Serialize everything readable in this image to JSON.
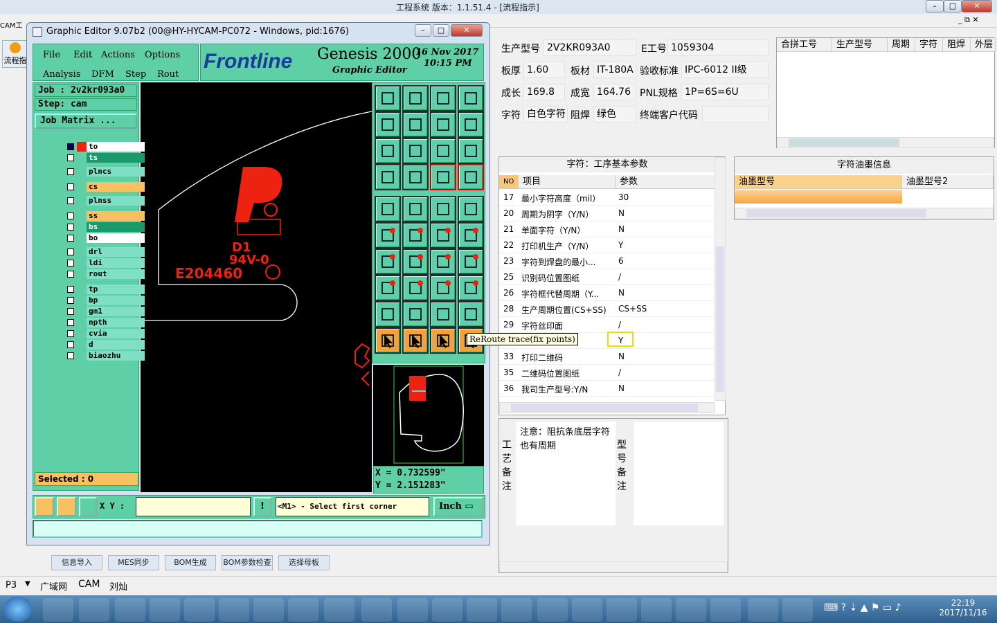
{
  "app_title": "工程系统   版本：1.1.51.4 - [流程指示]",
  "left_tab": "CAM工",
  "left_button": "流程指",
  "product": {
    "model_label": "生产型号",
    "model_value": "2V2KR093A0",
    "eno_label": "E工号",
    "eno_value": "1059304",
    "thick_label": "板厚",
    "thick_value": "1.60",
    "mat_label": "板材",
    "mat_value": "IT-180A",
    "std_label": "验收标准",
    "std_value": "IPC-6012 II级",
    "len_label": "成长",
    "len_value": "169.8",
    "wid_label": "成宽",
    "wid_value": "164.76",
    "pnl_label": "PNL规格",
    "pnl_value": "1P=6S=6U",
    "char_label": "字符",
    "char_value": "白色字符",
    "mask_label": "阻焊",
    "mask_value": "绿色",
    "cust_label": "终端客户代码",
    "cust_value": ""
  },
  "merge_table": {
    "headers": [
      "合拼工号",
      "生产型号",
      "周期",
      "字符",
      "阻焊",
      "外层"
    ]
  },
  "params": {
    "title": "字符：工序基本参数",
    "col_no": "NO",
    "col_item": "项目",
    "col_param": "参数",
    "rows": [
      {
        "no": "17",
        "item": "最小字符高度（mil）",
        "val": "30"
      },
      {
        "no": "20",
        "item": "周期为阴字（Y/N）",
        "val": "N"
      },
      {
        "no": "21",
        "item": "单面字符（Y/N）",
        "val": "N"
      },
      {
        "no": "22",
        "item": "打印机生产（Y/N）",
        "val": "Y"
      },
      {
        "no": "23",
        "item": "字符到焊盘的最小...",
        "val": "6"
      },
      {
        "no": "25",
        "item": "识别码位置图纸",
        "val": "/"
      },
      {
        "no": "26",
        "item": "字符框代替周期（Y...",
        "val": "N"
      },
      {
        "no": "28",
        "item": "生产周期位置(CS+SS)",
        "val": "CS+SS"
      },
      {
        "no": "29",
        "item": "字符丝印面",
        "val": "/"
      },
      {
        "no": "31",
        "item": "/N)",
        "val": "Y"
      },
      {
        "no": "33",
        "item": "打印二维码",
        "val": "N"
      },
      {
        "no": "35",
        "item": "二维码位置图纸",
        "val": "/"
      },
      {
        "no": "36",
        "item": "我司生产型号:Y/N",
        "val": "N"
      }
    ]
  },
  "ink": {
    "title": "字符油墨信息",
    "col1": "油墨型号",
    "col2": "油墨型号2"
  },
  "notes": {
    "proc_label": [
      "工",
      "艺",
      "备",
      "注"
    ],
    "proc_text": "注意：阻抗条底层字符也有周期",
    "model_label": [
      "型",
      "号",
      "备",
      "注"
    ]
  },
  "tooltip": "ReRoute trace(fix points)",
  "genesis": {
    "title": "Graphic Editor 9.07b2 (00@HY-HYCAM-PC072 - Windows, pid:1676)",
    "menu": [
      "File",
      "Edit",
      "Actions",
      "Options",
      "Analysis",
      "DFM",
      "Step",
      "Rout"
    ],
    "brand": "Frontline",
    "product": "Genesis 2000",
    "subtitle": "Graphic Editor",
    "date": "16 Nov 2017",
    "time": "10:15 PM",
    "job": "Job : 2v2kr093a0",
    "step": "Step: cam",
    "job_matrix": "Job Matrix ...",
    "layers": [
      "to",
      "ts",
      "plncs",
      "cs",
      "plnss",
      "ss",
      "bs",
      "bo",
      "drl",
      "ldi",
      "rout",
      "tp",
      "bp",
      "gm1",
      "npth",
      "cvia",
      "d",
      "biaozhu"
    ],
    "selected": "Selected : 0",
    "xy_label": "X Y :",
    "status": "<M1> - Select first corner",
    "unit": "Inch",
    "coord_x": "X = 0.732599\"",
    "coord_y": "Y = 2.151283\"",
    "pcb_text1": "D1",
    "pcb_text2": "94V-0",
    "pcb_text3": "E204460"
  },
  "bottom_buttons": [
    "信息导入",
    "MES同步",
    "BOM生成",
    "BOM参数检查",
    "选择母板"
  ],
  "status_bar": [
    "P3",
    "广域网",
    "CAM",
    "刘灿"
  ],
  "clock": {
    "time": "22:19",
    "date": "2017/11/16"
  }
}
